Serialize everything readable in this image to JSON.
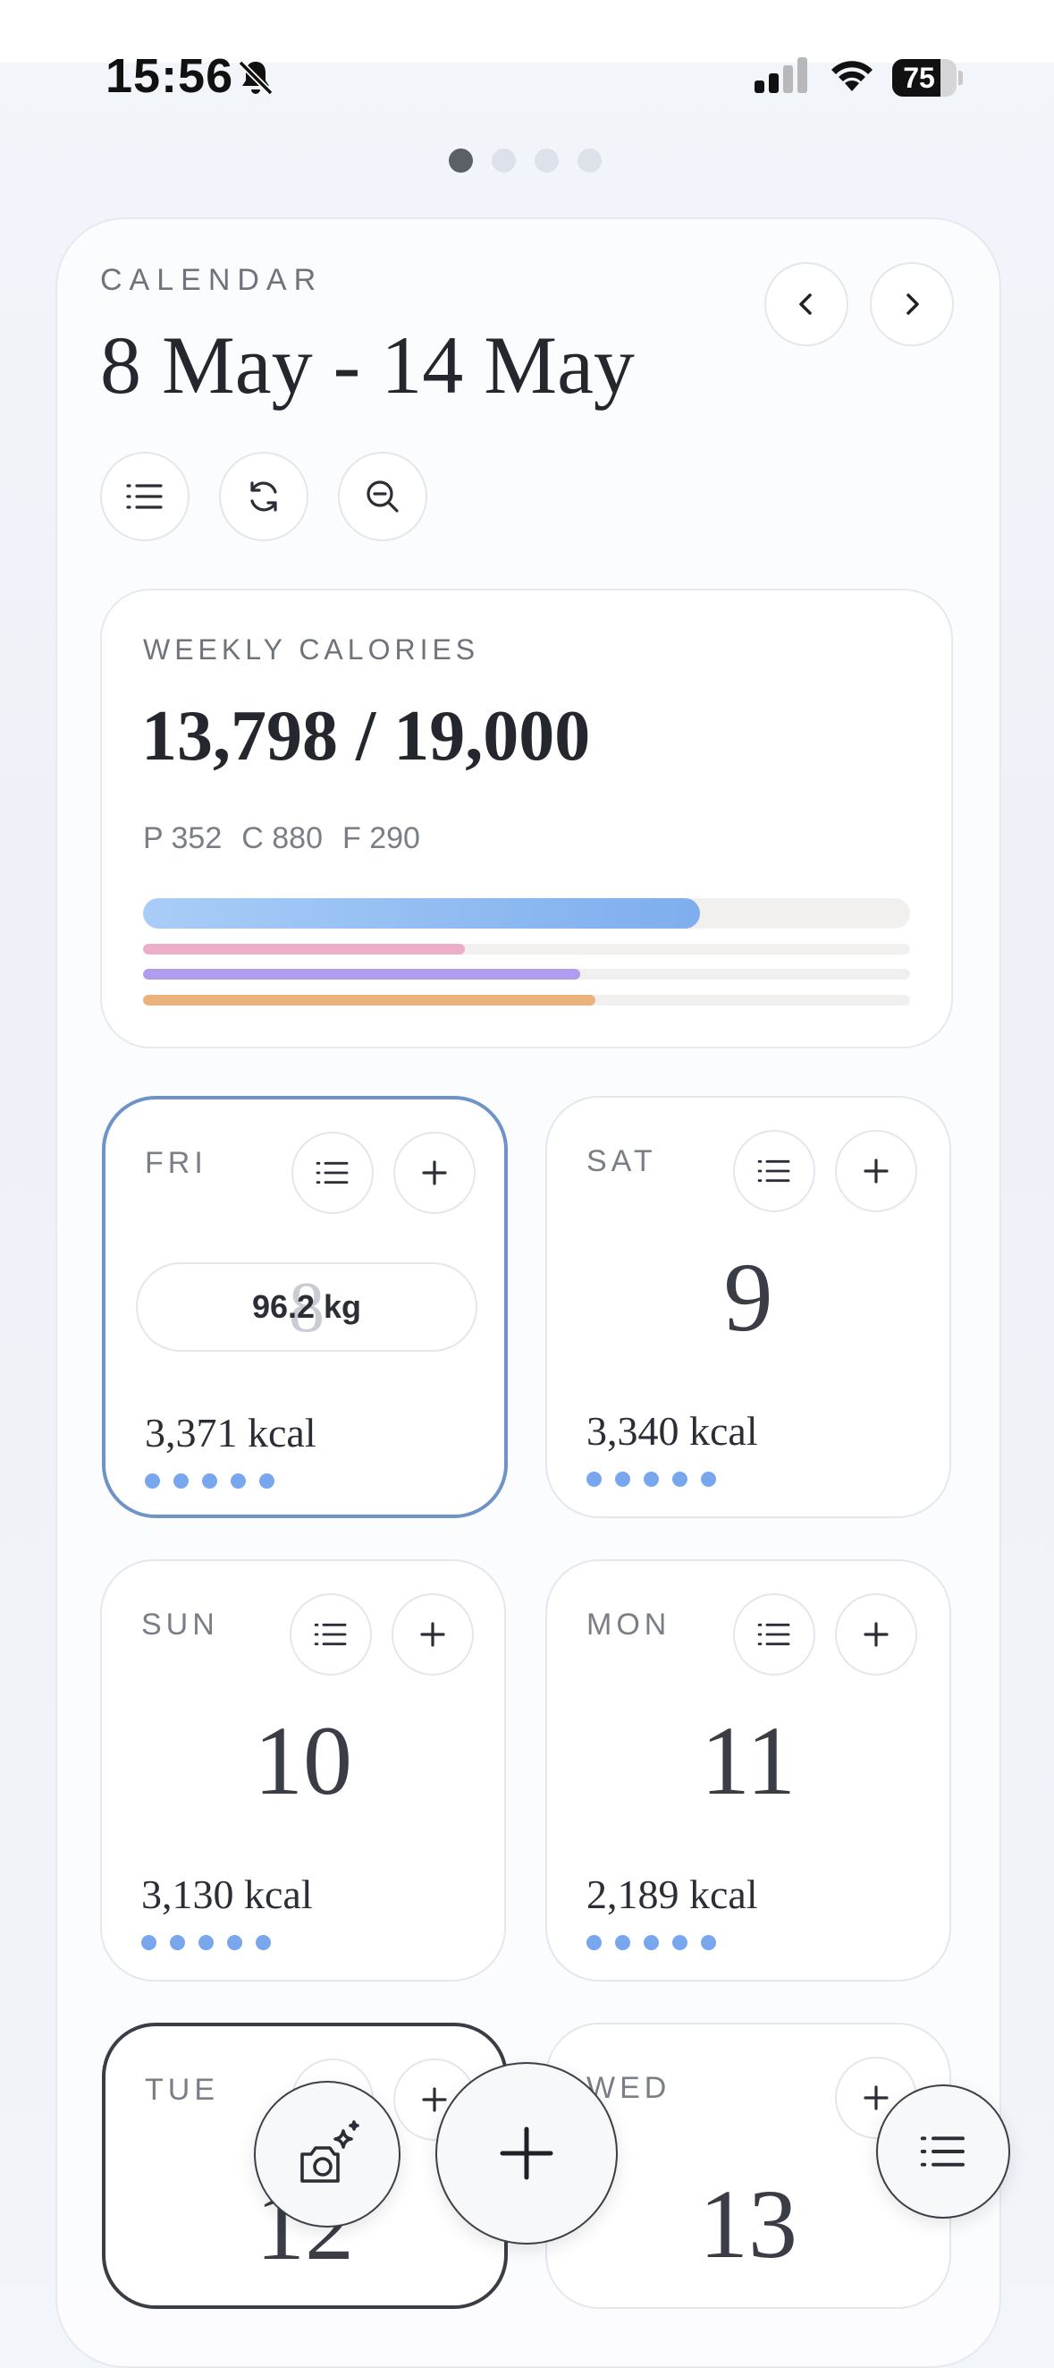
{
  "status_bar": {
    "time": "15:56",
    "battery": "75",
    "battery_level": 0.75
  },
  "page_indicator": {
    "count": 4,
    "active": 0
  },
  "header": {
    "section_label": "CALENDAR",
    "date_range": "8 May - 14 May"
  },
  "toolbar_icons": [
    "prev-arrow-icon",
    "next-arrow-icon",
    "list-icon",
    "refresh-icon",
    "zoom-out-icon"
  ],
  "weekly": {
    "label": "WEEKLY CALORIES",
    "total": "13,798 / 19,000",
    "protein": "P 352",
    "carbs": "C 880",
    "fat": "F 290",
    "progress": {
      "calories": 0.726,
      "protein": 0.42,
      "carbs": 0.57,
      "fat": 0.59
    },
    "colors": {
      "calories": "#7eaeee",
      "protein": "#ecadc8",
      "carbs": "#b09cef",
      "fat": "#ecb27e",
      "track": "#f1f0ee"
    }
  },
  "days": [
    {
      "name": "FRI",
      "number": "8",
      "kcal": "3,371 kcal",
      "weight": "96.2 kg",
      "selected": true
    },
    {
      "name": "SAT",
      "number": "9",
      "kcal": "3,340 kcal"
    },
    {
      "name": "SUN",
      "number": "10",
      "kcal": "3,130 kcal"
    },
    {
      "name": "MON",
      "number": "11",
      "kcal": "2,189 kcal"
    },
    {
      "name": "TUE",
      "number": "12",
      "today": true
    },
    {
      "name": "WED",
      "number": "13"
    }
  ],
  "accent_color": "#78a6ef"
}
